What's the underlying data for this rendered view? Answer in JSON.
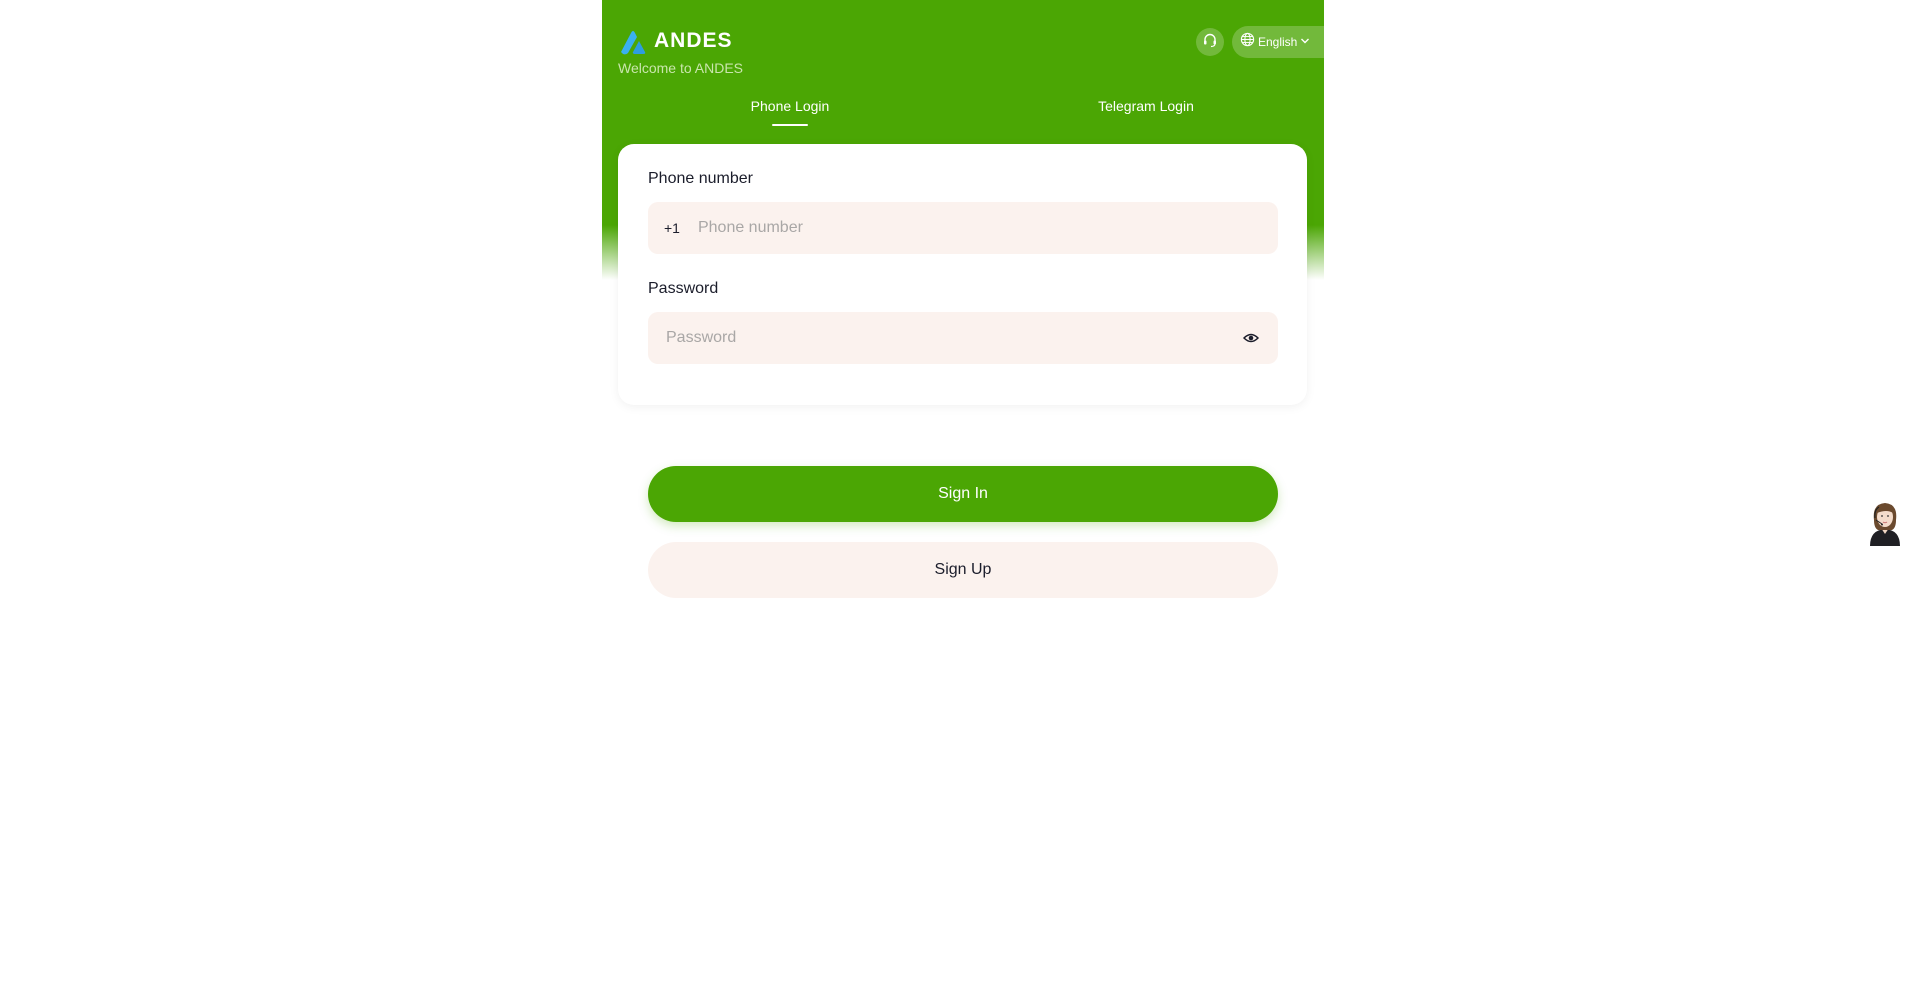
{
  "header": {
    "brand_name": "ANDES",
    "welcome_text": "Welcome to ANDES",
    "language": "English",
    "brand_color": "#4ba604",
    "logo_color": "#3ab0f0",
    "icons": {
      "logo": "andes-logo-icon",
      "support": "headset-icon",
      "language": "globe-icon",
      "dropdown": "chevron-down-icon"
    }
  },
  "tabs": [
    {
      "label": "Phone Login",
      "active": true
    },
    {
      "label": "Telegram Login",
      "active": false
    }
  ],
  "form": {
    "phone": {
      "label": "Phone number",
      "country_code": "+1",
      "placeholder": "Phone number",
      "value": ""
    },
    "password": {
      "label": "Password",
      "placeholder": "Password",
      "value": "",
      "toggle_icon": "eye-icon"
    }
  },
  "actions": {
    "sign_in": "Sign In",
    "sign_up": "Sign Up"
  },
  "support_agent": {
    "icon": "agent-avatar-icon"
  }
}
